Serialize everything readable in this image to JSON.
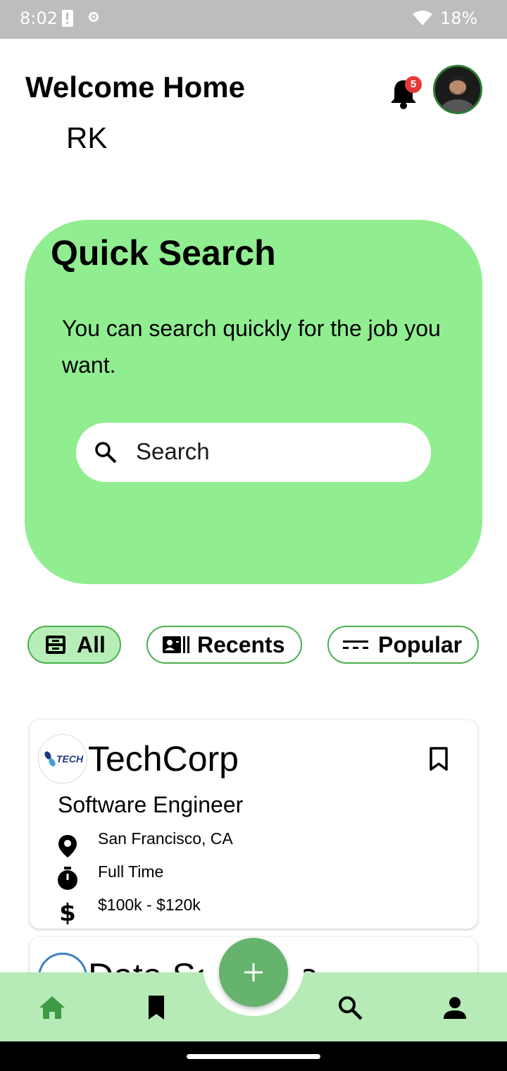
{
  "status_bar": {
    "time": "8:02",
    "battery": "18%"
  },
  "header": {
    "title": "Welcome Home",
    "username": "RK",
    "notification_count": "5"
  },
  "quick_search": {
    "title": "Quick Search",
    "description": "You can search quickly for the job you want.",
    "placeholder": "Search"
  },
  "filters": [
    {
      "label": "All",
      "icon": "inbox-icon",
      "selected": true
    },
    {
      "label": "Recents",
      "icon": "contact-card-icon",
      "selected": false
    },
    {
      "label": "Popular",
      "icon": "dashes-icon",
      "selected": false
    }
  ],
  "jobs": [
    {
      "company": "TechCorp",
      "logo_text": "TECH",
      "role": "Software Engineer",
      "location": "San Francisco, CA",
      "type": "Full Time",
      "salary": "$100k - $120k"
    },
    {
      "company": "Data Solutions"
    }
  ],
  "bottom_nav": [
    "home-icon",
    "bookmark-icon",
    "search-icon",
    "person-icon"
  ],
  "colors": {
    "accent_green": "#90ee90",
    "nav_bg": "#b6eab6",
    "fab": "#66b36e",
    "badge": "#e53935"
  }
}
